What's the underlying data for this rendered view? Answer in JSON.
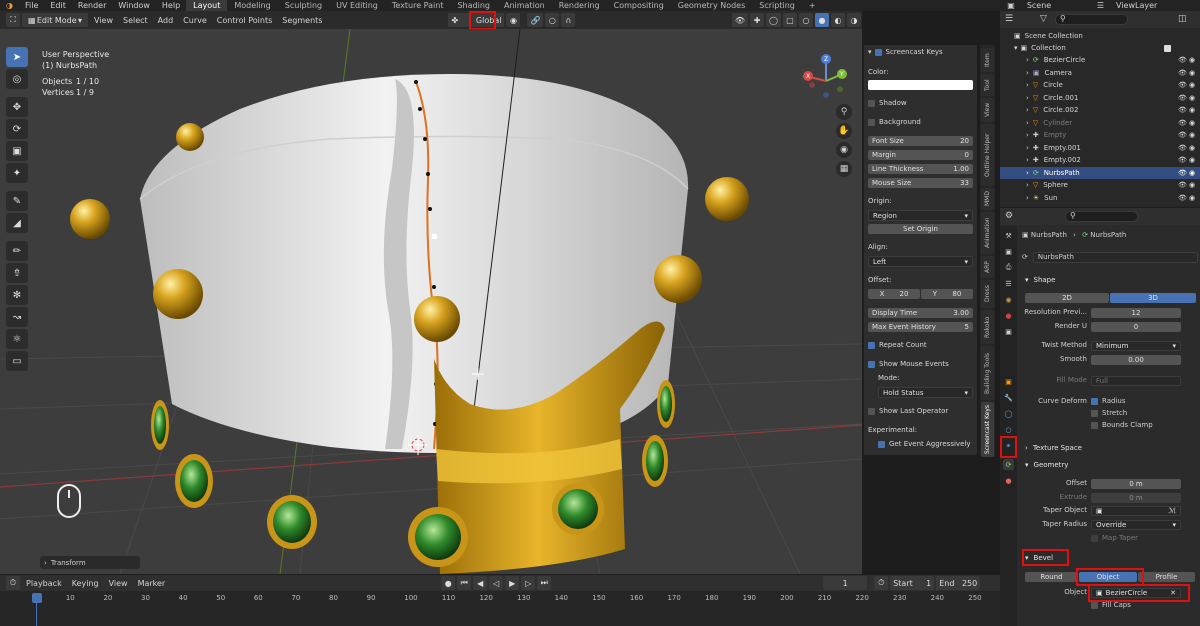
{
  "menubar": {
    "menus": [
      "File",
      "Edit",
      "Render",
      "Window",
      "Help"
    ],
    "workspaces": [
      "Layout",
      "Modeling",
      "Sculpting",
      "UV Editing",
      "Texture Paint",
      "Shading",
      "Animation",
      "Rendering",
      "Compositing",
      "Geometry Nodes",
      "Scripting"
    ],
    "active_workspace": "Layout",
    "add_tab": "+",
    "scene": "Scene",
    "view_layer": "ViewLayer"
  },
  "viewport_header": {
    "mode": "Edit Mode",
    "menus": [
      "View",
      "Select",
      "Add",
      "Curve",
      "Control Points",
      "Segments"
    ],
    "transform_orientation": "Global"
  },
  "viewport": {
    "view_name": "User Perspective",
    "object_name": "(1) NurbsPath",
    "stats": [
      {
        "label": "Objects",
        "value": "1 / 10"
      },
      {
        "label": "Vertices",
        "value": "1 / 9"
      }
    ],
    "operator_panel": "Transform",
    "gizmo_axes": [
      "Z",
      "Y",
      "X"
    ]
  },
  "npanel": {
    "title": "Screencast Keys",
    "color_label": "Color:",
    "color_value": "#ffffff",
    "shadow": "Shadow",
    "background": "Background",
    "fields": [
      {
        "label": "Font Size",
        "value": "20"
      },
      {
        "label": "Margin",
        "value": "0"
      },
      {
        "label": "Line Thickness",
        "value": "1.00"
      },
      {
        "label": "Mouse Size",
        "value": "33"
      }
    ],
    "origin_label": "Origin:",
    "origin_value": "Region",
    "set_origin": "Set Origin",
    "align_label": "Align:",
    "align_value": "Left",
    "offset_label": "Offset:",
    "offset_x_label": "X",
    "offset_x": "20",
    "offset_y_label": "Y",
    "offset_y": "80",
    "display_time_label": "Display Time",
    "display_time": "3.00",
    "max_history_label": "Max Event History",
    "max_history": "5",
    "repeat_count": "Repeat Count",
    "show_mouse_events": "Show Mouse Events",
    "mode_label": "Mode:",
    "mode_value": "Hold Status",
    "show_last_operator": "Show Last Operator",
    "experimental_label": "Experimental:",
    "get_event_aggressively": "Get Event Aggressively"
  },
  "side_tabs": [
    "Item",
    "Tool",
    "View",
    "Outline Helper",
    "MMD",
    "Animation",
    "ARP",
    "Dress",
    "Rokoko",
    "Building Tools",
    "Screencast Keys"
  ],
  "outliner": {
    "scene_collection": "Scene Collection",
    "collection": "Collection",
    "items": [
      {
        "name": "BezierCircle",
        "selected": false,
        "dim": false
      },
      {
        "name": "Camera",
        "selected": false,
        "dim": false
      },
      {
        "name": "Circle",
        "selected": false,
        "dim": false
      },
      {
        "name": "Circle.001",
        "selected": false,
        "dim": false
      },
      {
        "name": "Circle.002",
        "selected": false,
        "dim": false
      },
      {
        "name": "Cylinder",
        "selected": false,
        "dim": true
      },
      {
        "name": "Empty",
        "selected": false,
        "dim": true
      },
      {
        "name": "Empty.001",
        "selected": false,
        "dim": false
      },
      {
        "name": "Empty.002",
        "selected": false,
        "dim": false
      },
      {
        "name": "NurbsPath",
        "selected": true,
        "dim": false
      },
      {
        "name": "Sphere",
        "selected": false,
        "dim": false
      },
      {
        "name": "Sun",
        "selected": false,
        "dim": false
      }
    ]
  },
  "properties": {
    "breadcrumb_object": "NurbsPath",
    "breadcrumb_data": "NurbsPath",
    "datablock": "NurbsPath",
    "shape_section": "Shape",
    "dim_2d": "2D",
    "dim_3d": "3D",
    "resolution_preview_label": "Resolution Previ...",
    "resolution_preview": "12",
    "render_u_label": "Render U",
    "render_u": "0",
    "twist_method_label": "Twist Method",
    "twist_method": "Minimum",
    "smooth_label": "Smooth",
    "smooth": "0.00",
    "fill_mode_label": "Fill Mode",
    "fill_mode": "Full",
    "curve_deform_label": "Curve Deform",
    "radius": "Radius",
    "stretch": "Stretch",
    "bounds_clamp": "Bounds Clamp",
    "texture_space_section": "Texture Space",
    "geometry_section": "Geometry",
    "offset_label": "Offset",
    "offset": "0 m",
    "extrude_label": "Extrude",
    "extrude": "0 m",
    "taper_object_label": "Taper Object",
    "taper_radius_label": "Taper Radius",
    "taper_radius": "Override",
    "map_taper": "Map Taper",
    "bevel_section": "Bevel",
    "bevel_round": "Round",
    "bevel_object": "Object",
    "bevel_profile": "Profile",
    "bevel_object_label": "Object",
    "bevel_object_value": "BezierCircle",
    "fill_caps": "Fill Caps"
  },
  "timeline": {
    "menus": [
      "Playback",
      "Keying",
      "View",
      "Marker"
    ],
    "current_frame": "1",
    "start_label": "Start",
    "start": "1",
    "end_label": "End",
    "end": "250",
    "ticks": [
      "1",
      "10",
      "20",
      "30",
      "40",
      "50",
      "60",
      "70",
      "80",
      "90",
      "100",
      "110",
      "120",
      "130",
      "140",
      "150",
      "160",
      "170",
      "180",
      "190",
      "200",
      "210",
      "220",
      "230",
      "240",
      "250"
    ]
  },
  "colors": {
    "accent": "#4772b3",
    "highlight": "#e01010",
    "gold": "#d9a520",
    "curve": "#e07020"
  }
}
